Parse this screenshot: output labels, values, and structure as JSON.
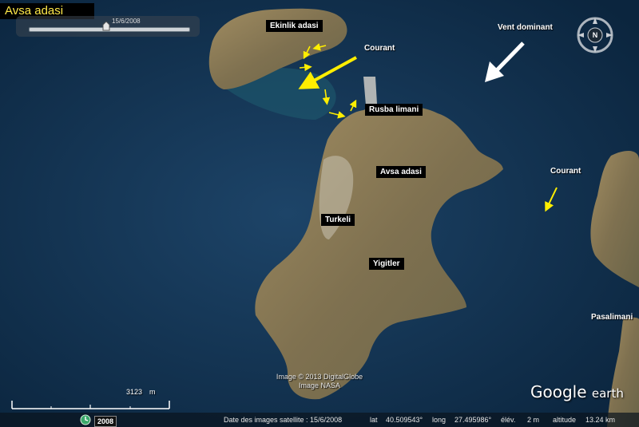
{
  "title": "Avsa adasi",
  "time_slider": {
    "date": "15/6/2008"
  },
  "labels": {
    "ekinlik": "Ekinlik adasi",
    "rusba": "Rusba limani",
    "avsa": "Avsa adasi",
    "turkeli": "Turkeli",
    "yigitler": "Yigitler",
    "courant_north": "Courant",
    "courant_east": "Courant",
    "vent": "Vent dominant",
    "pasalimani": "Pasalimani"
  },
  "compass": {
    "north": "N"
  },
  "credits": {
    "line1": "Image © 2013 DigitalGlobe",
    "line2": "Image NASA"
  },
  "scale": {
    "value": "3123",
    "unit": "m"
  },
  "status": {
    "year": "2008",
    "imagery_date": "Date des images satellite : 15/6/2008",
    "lat_label": "lat",
    "lat_value": "40.509543°",
    "long_label": "long",
    "long_value": "27.495986°",
    "elev_label": "élév.",
    "elev_value": "2 m",
    "alt_label": "altitude",
    "alt_value": "13.24 km"
  },
  "logo": {
    "text": "Google",
    "suffix": "earth"
  },
  "colors": {
    "sea": "#13324f",
    "land": "#8a7b55",
    "arrow_current": "#ffee00",
    "arrow_wind": "#ffffff"
  },
  "icons": [
    "compass-icon",
    "slider-thumb-icon",
    "history-clock-icon"
  ]
}
